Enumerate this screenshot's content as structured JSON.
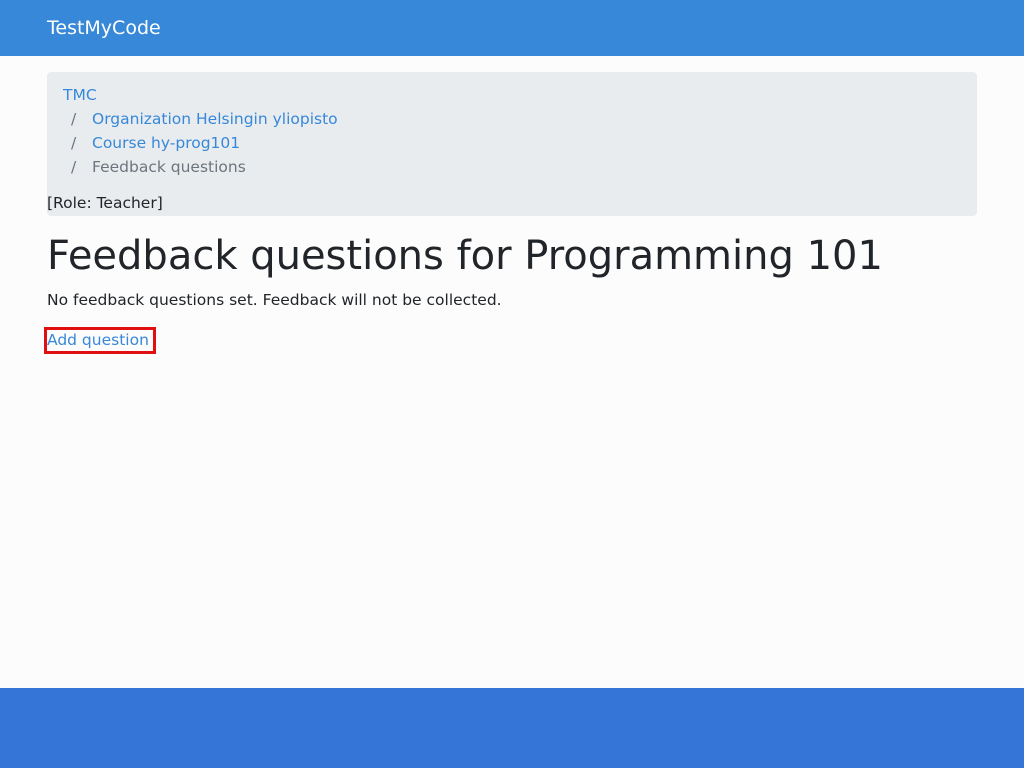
{
  "navbar": {
    "brand": "TestMyCode",
    "color": "#3788d8"
  },
  "breadcrumb": {
    "items": [
      {
        "label": "TMC",
        "link": true
      },
      {
        "label": "Organization Helsingin yliopisto",
        "link": true
      },
      {
        "label": "Course hy-prog101",
        "link": true
      },
      {
        "label": "Feedback questions",
        "link": false
      }
    ],
    "separator": "/",
    "role": "[Role: Teacher]"
  },
  "main": {
    "title": "Feedback questions for Programming 101",
    "message": "No feedback questions set. Feedback will not be collected.",
    "add_question_label": "Add question"
  },
  "colors": {
    "link": "#3788d8",
    "highlight_border": "#e01010",
    "footer": "#3575d8",
    "breadcrumb_bg": "#e9ecef"
  }
}
